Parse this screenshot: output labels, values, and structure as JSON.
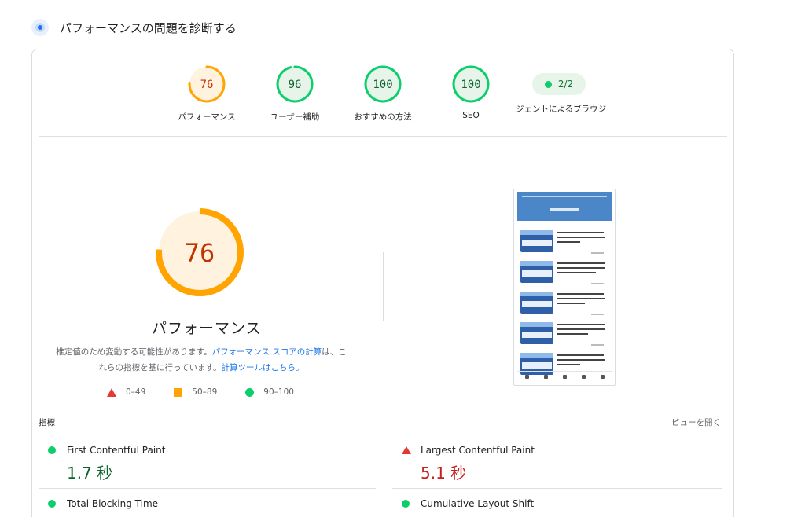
{
  "header": {
    "title": "パフォーマンスの問題を診断する",
    "icon": "diagnostic-icon"
  },
  "gauges": [
    {
      "score": "76",
      "label": "パフォーマンス",
      "fraction": 0.76,
      "status": "average"
    },
    {
      "score": "96",
      "label": "ユーザー補助",
      "fraction": 0.96,
      "status": "pass"
    },
    {
      "score": "100",
      "label": "おすすめの方法",
      "fraction": 1.0,
      "status": "pass"
    },
    {
      "score": "100",
      "label": "SEO",
      "fraction": 1.0,
      "status": "pass"
    }
  ],
  "agent": {
    "score": "2/2",
    "label": "ジェントによるブラウジ"
  },
  "performance": {
    "score": "76",
    "fraction": 0.76,
    "title": "パフォーマンス",
    "desc_before": "推定値のため変動する可能性があります。",
    "desc_link1": "パフォーマンス スコアの計算",
    "desc_middle": "は、これらの指標を基に行っています。",
    "desc_link2": "計算ツールはこちら。"
  },
  "legend": {
    "fail": "0–49",
    "average": "50–89",
    "pass": "90–100"
  },
  "metrics_section": {
    "label": "指標",
    "expand": "ビューを開く"
  },
  "metrics": [
    {
      "name": "First Contentful Paint",
      "value": "1.7 秒",
      "status": "pass"
    },
    {
      "name": "Largest Contentful Paint",
      "value": "5.1 秒",
      "status": "fail"
    },
    {
      "name": "Total Blocking Time",
      "value": "",
      "status": "pass"
    },
    {
      "name": "Cumulative Layout Shift",
      "value": "",
      "status": "pass"
    }
  ],
  "colors": {
    "pass": "#0cce6b",
    "average": "#ffa400",
    "fail": "#ff4e42",
    "pass_text": "#0d652d",
    "average_text": "#c33300",
    "fail_text": "#c5221f",
    "link": "#1a73e8"
  }
}
